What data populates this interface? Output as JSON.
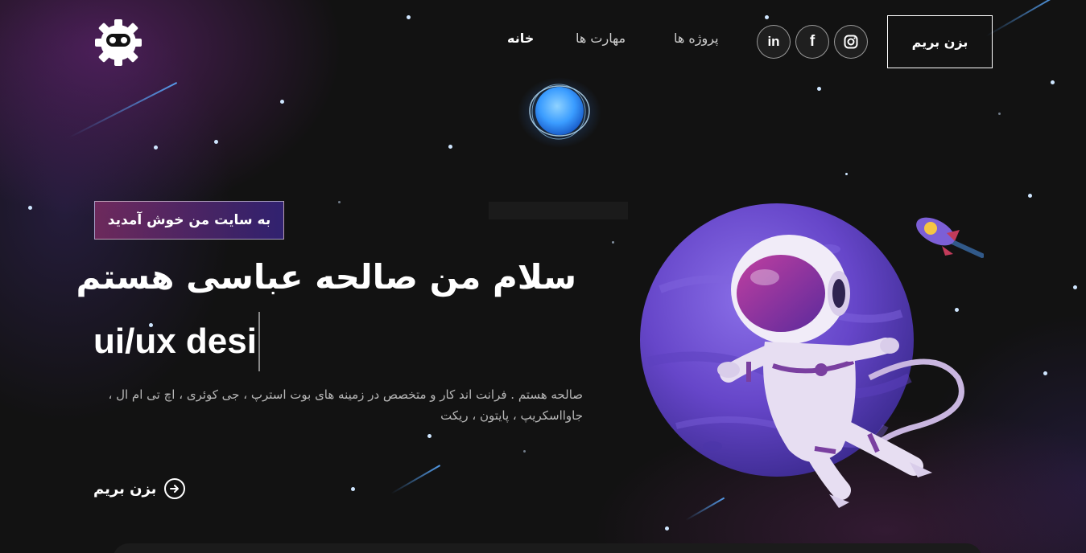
{
  "nav": {
    "links": [
      "خانه",
      "مهارت ها",
      "پروژه ها"
    ],
    "active_index": 0,
    "social": [
      "linkedin-icon",
      "facebook-icon",
      "instagram-icon"
    ],
    "cta_label": "بزن بریم"
  },
  "hero": {
    "tagline": "به سایت من خوش آمدید",
    "headline": "سلام من صالحه عباسی هستم",
    "typed_text": "ui/ux desi",
    "description": "صالحه هستم . فرانت اند کار و متخصص در زمینه های بوت استرپ ، جی کوئری ، اچ تی ام ال ، جاوااسکریپ ، پایتون ، ریکت",
    "cta_label": "بزن بریم"
  },
  "colors": {
    "background": "#121212",
    "accent_pink": "#aa367c",
    "accent_purple": "#4a2fbd",
    "planet": "#6b4fd0"
  }
}
